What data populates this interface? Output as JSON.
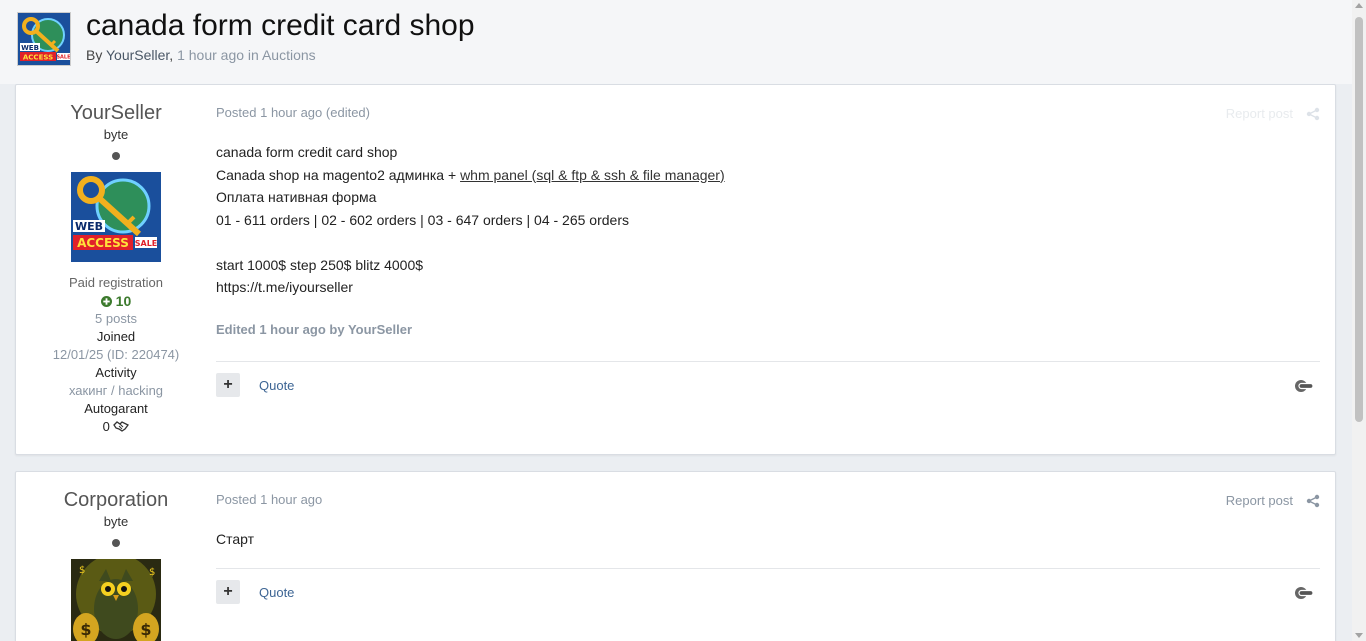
{
  "topic": {
    "title": "canada form credit card shop",
    "by_label": "By",
    "author": "YourSeller",
    "comma": ",",
    "time": "1 hour ago",
    "in_label": "in",
    "forum": "Auctions",
    "avatar_icon": "web-access-key-logo"
  },
  "posts": [
    {
      "author": "YourSeller",
      "rank": "byte",
      "avatar_icon": "web-access-key-logo",
      "group": "Paid registration",
      "reputation": "10",
      "posts_count": "5 posts",
      "joined_label": "Joined",
      "joined_value": "12/01/25 (ID: 220474)",
      "activity_label": "Activity",
      "activity_value": "хакинг / hacking",
      "autogarant_label": "Autogarant",
      "autogarant_value": "0",
      "posted_label": "Posted",
      "posted_time": "1 hour ago",
      "posted_suffix": "(edited)",
      "report_label": "Report post",
      "content": {
        "line1": "canada form credit card shop",
        "line2_prefix": "Canada shop на magento2 админка + ",
        "line2_link": "whm panel (sql & ftp & ssh & file manager)",
        "line3": "Оплата нативная форма",
        "line4": "01 - 611 orders | 02 - 602 orders | 03 - 647 orders | 04 - 265 orders",
        "line5": "start 1000$ step 250$ blitz 4000$",
        "line6": "https://t.me/iyourseller"
      },
      "edited_note": "Edited 1 hour ago by YourSeller",
      "plus_label": "+",
      "quote_label": "Quote"
    },
    {
      "author": "Corporation",
      "rank": "byte",
      "avatar_icon": "owl-money-avatar",
      "posted_label": "Posted",
      "posted_time": "1 hour ago",
      "report_label": "Report post",
      "content": {
        "line1": "Старт"
      },
      "plus_label": "+",
      "quote_label": "Quote"
    }
  ],
  "colors": {
    "page_bg": "#ebeef2",
    "header_bg": "#f5f6f8",
    "link": "#3d6594",
    "muted": "#8b96a3",
    "reputation": "#3c7a2d"
  }
}
